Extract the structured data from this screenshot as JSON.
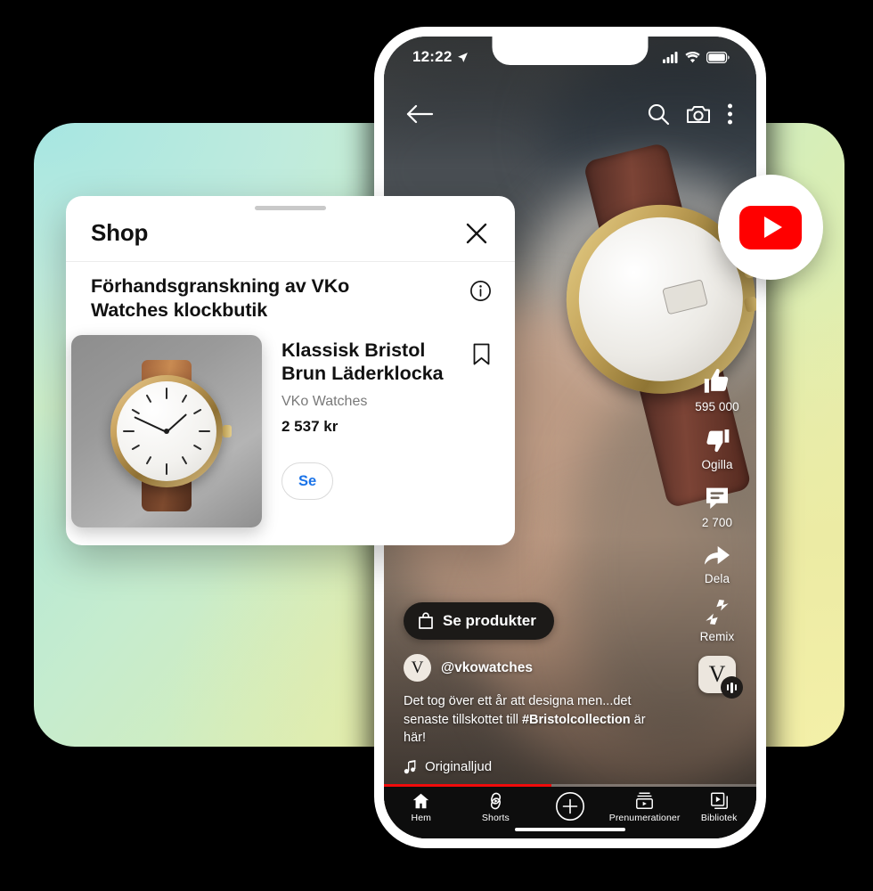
{
  "phone": {
    "status_bar": {
      "time": "12:22",
      "location_icon": "location-arrow-icon",
      "signal_icon": "cellular-signal-icon",
      "wifi_icon": "wifi-icon",
      "battery_icon": "battery-icon"
    },
    "top_bar": {
      "back_icon": "back-arrow-icon",
      "search_icon": "search-icon",
      "camera_icon": "camera-icon",
      "more_icon": "more-vertical-icon"
    },
    "action_rail": [
      {
        "name": "like",
        "icon": "thumbs-up-icon",
        "label": "595 000"
      },
      {
        "name": "dislike",
        "icon": "thumbs-down-icon",
        "label": "Ogilla"
      },
      {
        "name": "comment",
        "icon": "comment-icon",
        "label": "2 700"
      },
      {
        "name": "share",
        "icon": "share-arrow-icon",
        "label": "Dela"
      },
      {
        "name": "remix",
        "icon": "remix-icon",
        "label": "Remix"
      }
    ],
    "sound_thumb": {
      "letter": "V",
      "badge_icon": "audio-waveform-icon"
    },
    "video_info": {
      "shop_button": {
        "label": "Se produkter",
        "icon": "shopping-bag-icon"
      },
      "channel": {
        "avatar_letter": "V",
        "handle": "@vkowatches"
      },
      "caption_before": "Det tog över ett år att designa men...det senaste tillskottet till ",
      "caption_hashtag": "#Bristolcollection",
      "caption_after": " är här!",
      "sound": {
        "icon": "music-note-icon",
        "label": "Originalljud"
      }
    },
    "progress": {
      "percent": 45,
      "color": "#f00b0b"
    },
    "bottom_nav": [
      {
        "icon": "home-icon",
        "label": "Hem"
      },
      {
        "icon": "shorts-icon",
        "label": "Shorts"
      },
      {
        "icon": "plus-circle-icon",
        "label": ""
      },
      {
        "icon": "subscriptions-icon",
        "label": "Prenumerationer"
      },
      {
        "icon": "library-icon",
        "label": "Bibliotek"
      }
    ]
  },
  "youtube_badge": {
    "icon": "youtube-logo-icon",
    "color": "#ff0000"
  },
  "shop_sheet": {
    "title": "Shop",
    "close_icon": "close-icon",
    "info_icon": "info-circle-icon",
    "bookmark_icon": "bookmark-icon",
    "store_title": "Förhandsgranskning av VKo Watches klockbutik",
    "product": {
      "image_alt": "brown-leather-watch-image",
      "name": "Klassisk Bristol Brun Läderklocka",
      "brand": "VKo Watches",
      "price": "2 537 kr",
      "cta_label": "Se",
      "cta_color": "#1a73e8"
    }
  },
  "background": {
    "gradient_start": "#9fe4e0",
    "gradient_mid": "#cdeec9",
    "gradient_end": "#f2efa6"
  }
}
